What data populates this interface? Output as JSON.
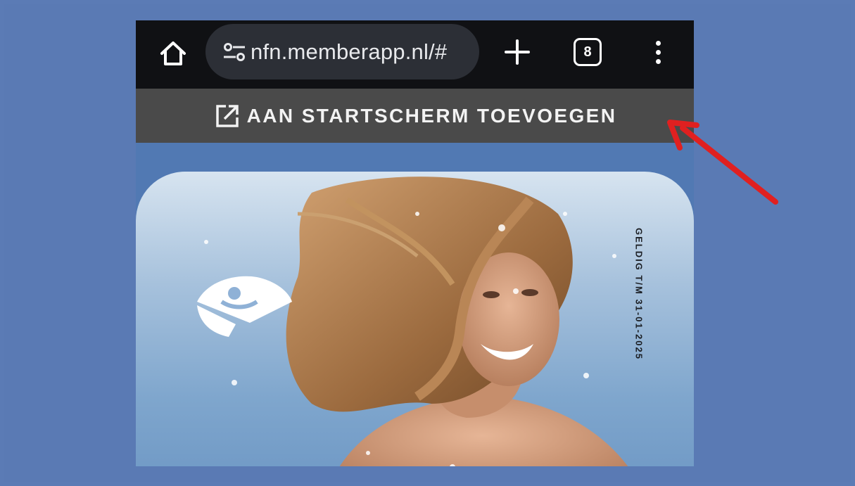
{
  "browser": {
    "url": "nfn.memberapp.nl/#",
    "tab_count": "8",
    "icons": [
      "home-icon",
      "site-settings-icon",
      "plus-icon",
      "tabs-icon",
      "more-vertical-icon"
    ]
  },
  "banner": {
    "label": "AAN STARTSCHERM TOEVOEGEN",
    "icon": "open-external-icon"
  },
  "card": {
    "validity": "GELDIG T/M 31-01-2025",
    "logo": "nfn-logo"
  },
  "annotation": {
    "arrow_color": "#e02020"
  },
  "colors": {
    "background": "#5b7bb5",
    "browser_bar": "#101114",
    "url_box": "#2c2f36",
    "banner": "#4a4a4a"
  }
}
